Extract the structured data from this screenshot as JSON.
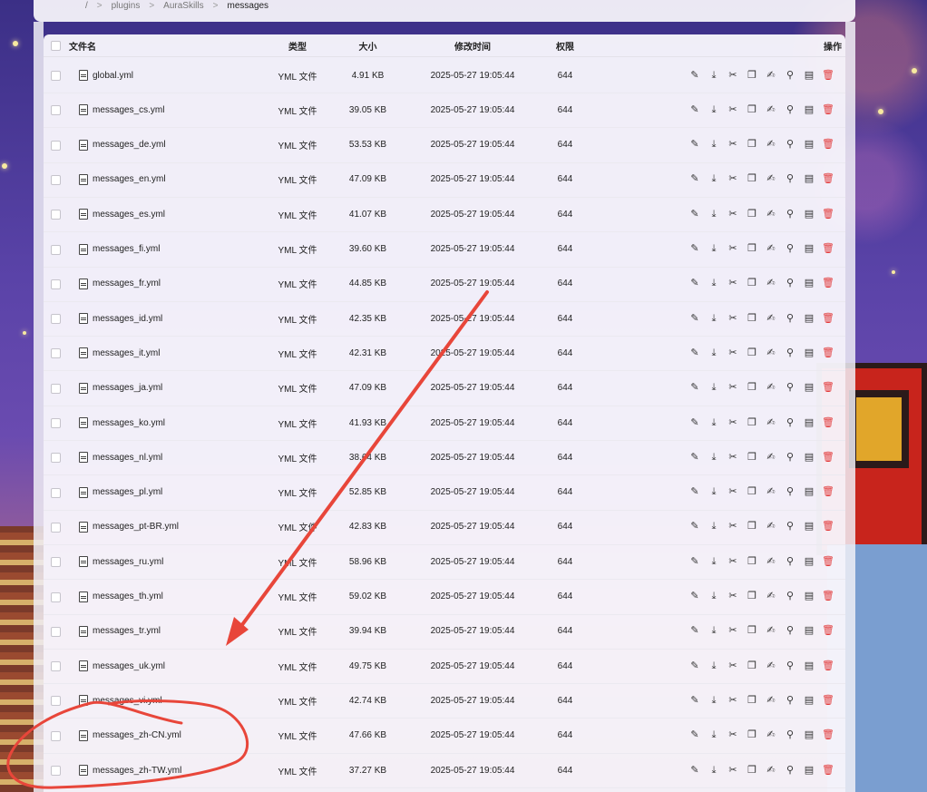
{
  "breadcrumb": {
    "root": "/",
    "sep": ">",
    "items": [
      "plugins",
      "AuraSkills",
      "messages"
    ]
  },
  "table": {
    "columns": {
      "name": "文件名",
      "type": "类型",
      "size": "大小",
      "modified": "修改时间",
      "perms": "权限",
      "actions": "操作"
    },
    "rows": [
      {
        "name": "global.yml",
        "type": "YML 文件",
        "size": "4.91 KB",
        "modified": "2025-05-27 19:05:44",
        "perms": "644"
      },
      {
        "name": "messages_cs.yml",
        "type": "YML 文件",
        "size": "39.05 KB",
        "modified": "2025-05-27 19:05:44",
        "perms": "644"
      },
      {
        "name": "messages_de.yml",
        "type": "YML 文件",
        "size": "53.53 KB",
        "modified": "2025-05-27 19:05:44",
        "perms": "644"
      },
      {
        "name": "messages_en.yml",
        "type": "YML 文件",
        "size": "47.09 KB",
        "modified": "2025-05-27 19:05:44",
        "perms": "644"
      },
      {
        "name": "messages_es.yml",
        "type": "YML 文件",
        "size": "41.07 KB",
        "modified": "2025-05-27 19:05:44",
        "perms": "644"
      },
      {
        "name": "messages_fi.yml",
        "type": "YML 文件",
        "size": "39.60 KB",
        "modified": "2025-05-27 19:05:44",
        "perms": "644"
      },
      {
        "name": "messages_fr.yml",
        "type": "YML 文件",
        "size": "44.85 KB",
        "modified": "2025-05-27 19:05:44",
        "perms": "644"
      },
      {
        "name": "messages_id.yml",
        "type": "YML 文件",
        "size": "42.35 KB",
        "modified": "2025-05-27 19:05:44",
        "perms": "644"
      },
      {
        "name": "messages_it.yml",
        "type": "YML 文件",
        "size": "42.31 KB",
        "modified": "2025-05-27 19:05:44",
        "perms": "644"
      },
      {
        "name": "messages_ja.yml",
        "type": "YML 文件",
        "size": "47.09 KB",
        "modified": "2025-05-27 19:05:44",
        "perms": "644"
      },
      {
        "name": "messages_ko.yml",
        "type": "YML 文件",
        "size": "41.93 KB",
        "modified": "2025-05-27 19:05:44",
        "perms": "644"
      },
      {
        "name": "messages_nl.yml",
        "type": "YML 文件",
        "size": "38.64 KB",
        "modified": "2025-05-27 19:05:44",
        "perms": "644"
      },
      {
        "name": "messages_pl.yml",
        "type": "YML 文件",
        "size": "52.85 KB",
        "modified": "2025-05-27 19:05:44",
        "perms": "644"
      },
      {
        "name": "messages_pt-BR.yml",
        "type": "YML 文件",
        "size": "42.83 KB",
        "modified": "2025-05-27 19:05:44",
        "perms": "644"
      },
      {
        "name": "messages_ru.yml",
        "type": "YML 文件",
        "size": "58.96 KB",
        "modified": "2025-05-27 19:05:44",
        "perms": "644"
      },
      {
        "name": "messages_th.yml",
        "type": "YML 文件",
        "size": "59.02 KB",
        "modified": "2025-05-27 19:05:44",
        "perms": "644"
      },
      {
        "name": "messages_tr.yml",
        "type": "YML 文件",
        "size": "39.94 KB",
        "modified": "2025-05-27 19:05:44",
        "perms": "644"
      },
      {
        "name": "messages_uk.yml",
        "type": "YML 文件",
        "size": "49.75 KB",
        "modified": "2025-05-27 19:05:44",
        "perms": "644"
      },
      {
        "name": "messages_vi.yml",
        "type": "YML 文件",
        "size": "42.74 KB",
        "modified": "2025-05-27 19:05:44",
        "perms": "644"
      },
      {
        "name": "messages_zh-CN.yml",
        "type": "YML 文件",
        "size": "47.66 KB",
        "modified": "2025-05-27 19:05:44",
        "perms": "644"
      },
      {
        "name": "messages_zh-TW.yml",
        "type": "YML 文件",
        "size": "37.27 KB",
        "modified": "2025-05-27 19:05:44",
        "perms": "644"
      }
    ],
    "row_actions": [
      {
        "icon": "rename-icon",
        "glyph": "✎"
      },
      {
        "icon": "download-icon",
        "glyph": "⤓"
      },
      {
        "icon": "cut-icon",
        "glyph": "✂"
      },
      {
        "icon": "copy-icon",
        "glyph": "❐"
      },
      {
        "icon": "edit-icon",
        "glyph": "✍"
      },
      {
        "icon": "search-icon",
        "glyph": "⚲"
      },
      {
        "icon": "file-info-icon",
        "glyph": "▤"
      },
      {
        "icon": "delete-icon",
        "glyph": "🗑"
      }
    ]
  },
  "colors": {
    "annotation": "#e8463a",
    "delete": "#e23a3a",
    "panel": "#f8f6fc"
  }
}
